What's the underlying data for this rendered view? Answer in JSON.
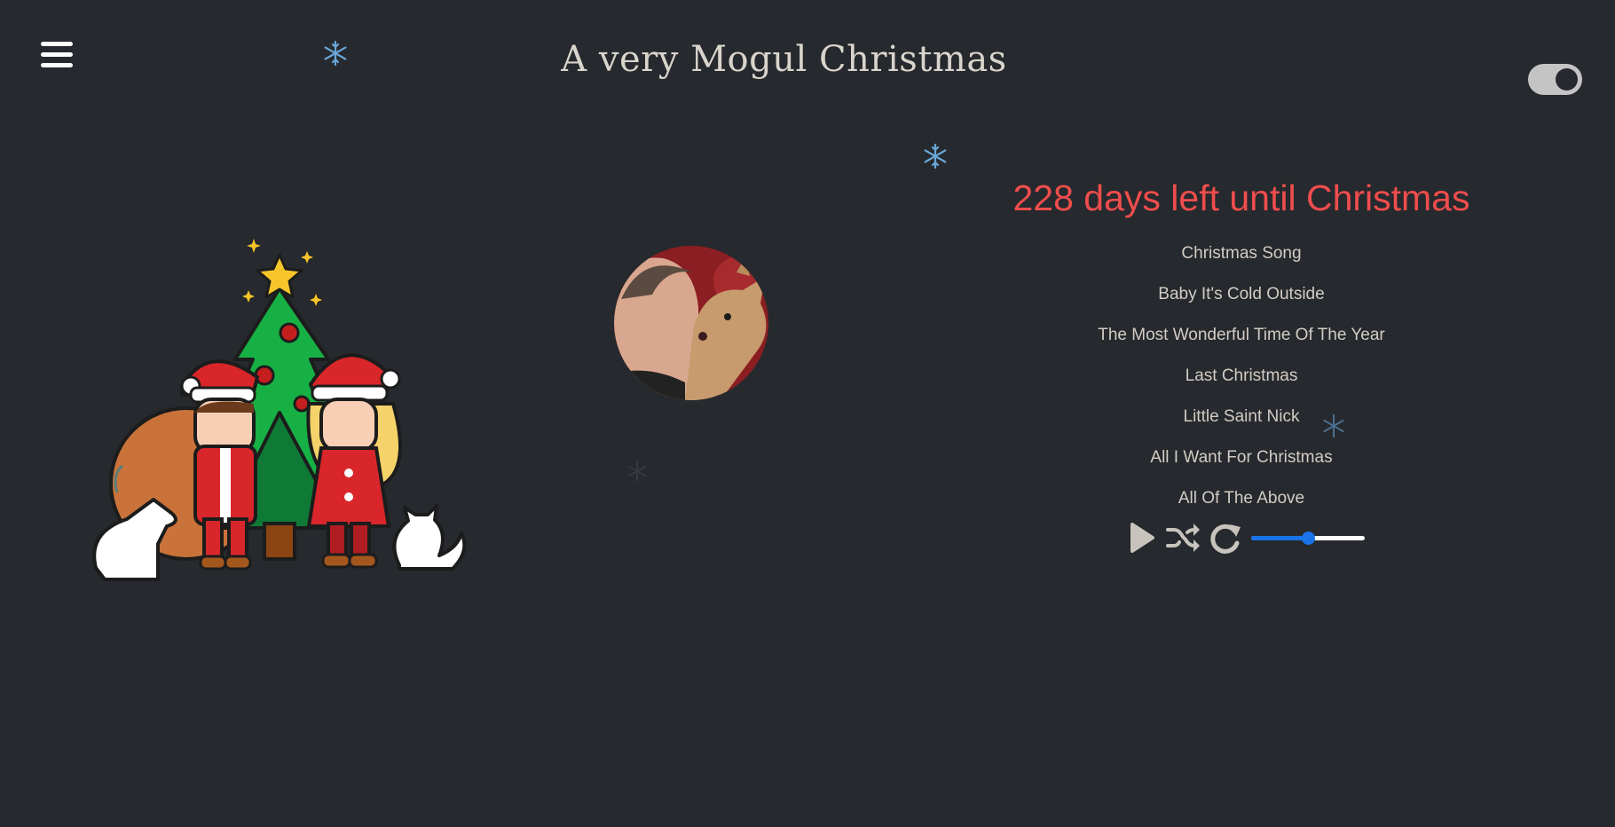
{
  "header": {
    "title": "A very Mogul Christmas",
    "menu_icon": "hamburger-menu-icon",
    "theme_toggle": {
      "state": "on"
    }
  },
  "countdown": {
    "text": "228 days left until Christmas",
    "color": "#ef4d4d"
  },
  "playlist": {
    "songs": [
      "Christmas Song",
      "Baby It's Cold Outside",
      "The Most Wonderful Time Of The Year",
      "Last Christmas",
      "Little Saint Nick",
      "All I Want For Christmas",
      "All Of The Above"
    ]
  },
  "player": {
    "play_icon": "play-icon",
    "shuffle_icon": "shuffle-icon",
    "repeat_icon": "repeat-icon",
    "volume": 0.5,
    "accent_color": "#1a73e8"
  },
  "images": {
    "illustration": "christmas-family-illustration",
    "album_art": "album-art-man-kissing-deer"
  },
  "colors": {
    "background": "#26292d",
    "title": "#d9d4cc",
    "song_text": "#d2ccc4"
  }
}
